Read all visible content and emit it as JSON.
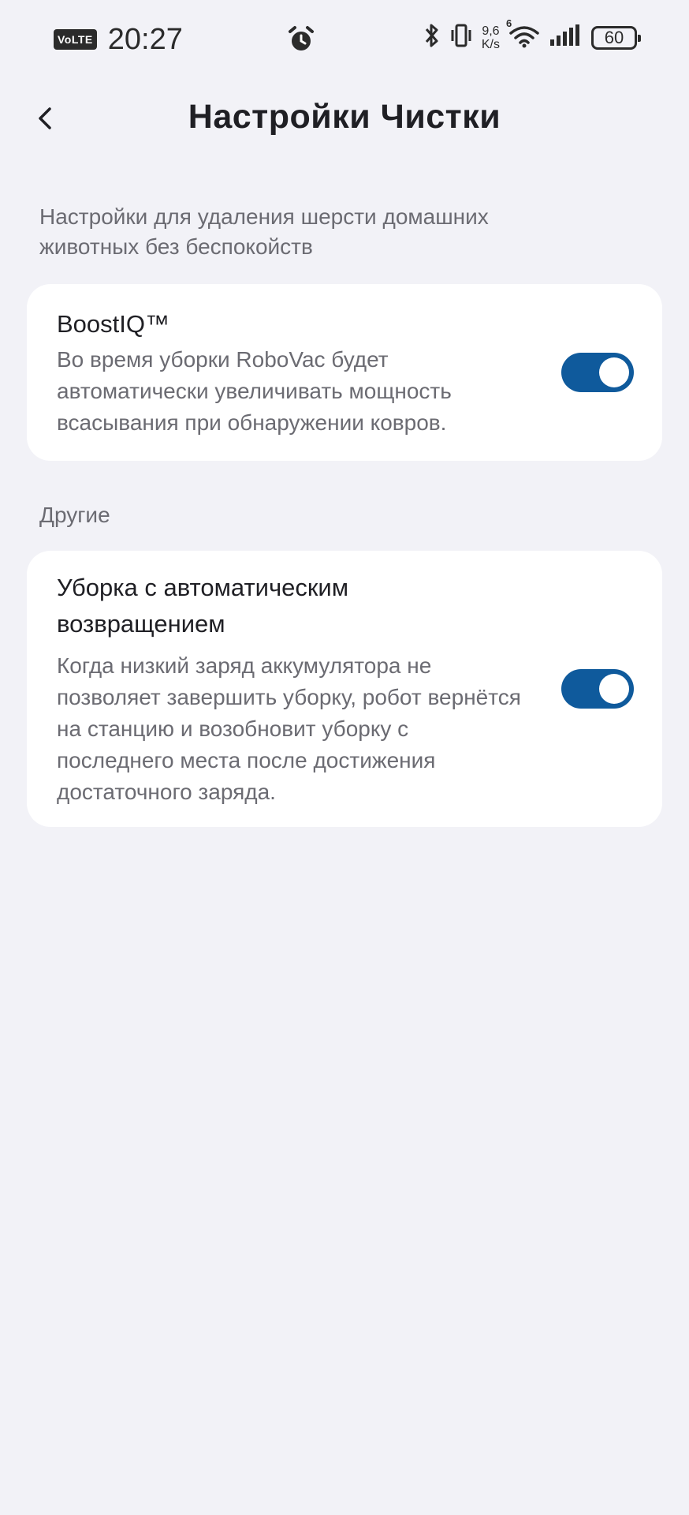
{
  "status_bar": {
    "volte": "VoLTE",
    "time": "20:27",
    "net_speed_value": "9,6",
    "net_speed_unit": "K/s",
    "wifi_badge": "6",
    "battery": "60",
    "icons": [
      "alarm-icon",
      "bluetooth-icon",
      "vibrate-icon",
      "wifi-icon",
      "signal-icon",
      "battery-icon"
    ]
  },
  "header": {
    "title": "Настройки Чистки",
    "back_icon": "chevron-left-icon"
  },
  "pet_section": {
    "caption": "Настройки для удаления шерсти домашних животных без беспокойств",
    "boostiq": {
      "title": "BoostIQ™",
      "description": "Во время уборки RoboVac будет автоматически увеличивать мощность всасывания при обнаружении ковров.",
      "enabled": true
    }
  },
  "other_section": {
    "caption": "Другие",
    "auto_return": {
      "title": "Уборка с автоматическим возвращением",
      "description": "Когда низкий заряд аккумулятора не позволяет завершить уборку, робот вернётся на станцию и возобновит уборку с последнего места после достижения достаточного заряда.",
      "enabled": true
    }
  },
  "colors": {
    "background": "#f2f2f7",
    "card": "#ffffff",
    "toggle_on": "#0f5a9c",
    "text_primary": "#1f1f24",
    "text_secondary": "#6b6b72"
  }
}
